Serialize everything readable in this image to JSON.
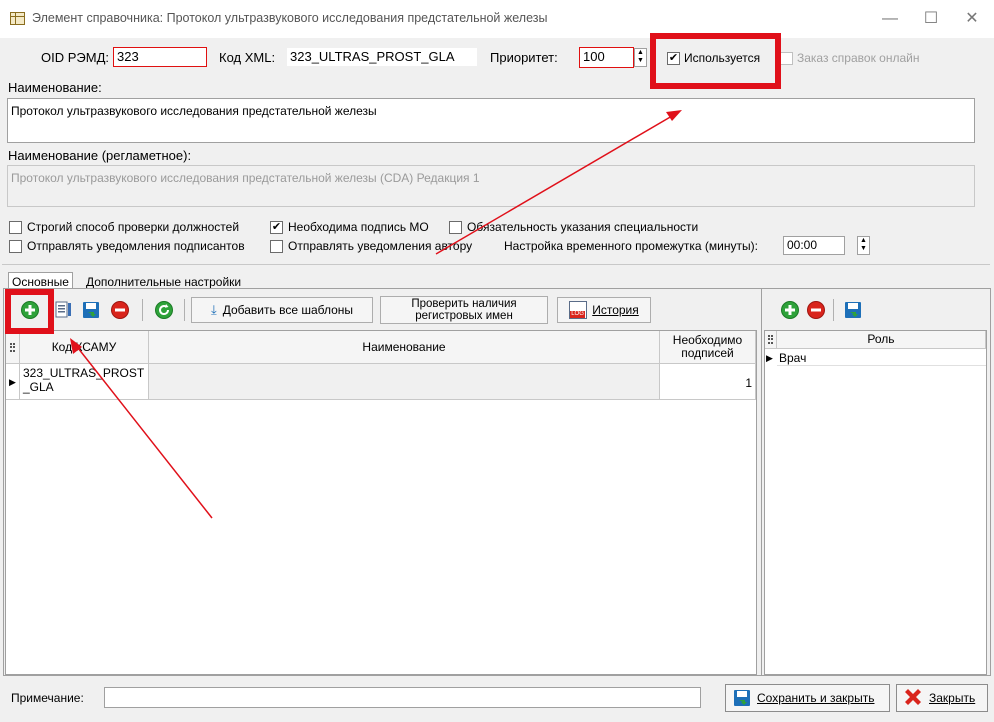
{
  "window": {
    "title": "Элемент справочника: Протокол ультразвукового исследования предстательной железы",
    "minimize": "—",
    "maximize": "☐",
    "close": "✕"
  },
  "fields": {
    "oid_label": "OID РЭМД:",
    "oid_value": "323",
    "xml_label": "Код XML:",
    "xml_value": "323_ULTRAS_PROST_GLA",
    "priority_label": "Приоритет:",
    "priority_value": "100",
    "used_label": "Используется",
    "used_checked": true,
    "online_order_label": "Заказ справок онлайн",
    "name_label": "Наименование:",
    "name_value": "Протокол ультразвукового исследования предстательной железы",
    "reg_name_label": "Наименование (регламетное):",
    "reg_name_value": "Протокол ультразвукового исследования предстательной железы (CDA) Редакция 1"
  },
  "options": {
    "strict_positions": "Строгий способ проверки должностей",
    "mo_signature": "Необходима подпись МО",
    "specialty_required": "Обязательность указания специальности",
    "notify_signers": "Отправлять уведомления подписантов",
    "notify_author": "Отправлять уведомления автору",
    "time_range_label": "Настройка временного промежутка (минуты):",
    "time_range_value": "00:00",
    "mo_signature_checked": true
  },
  "tabs": [
    {
      "label": "Основные"
    },
    {
      "label": "Дополнительные настройки"
    }
  ],
  "toolbar": {
    "add_all_templates": "Добавить все шаблоны",
    "check_names_line1": "Проверить наличия",
    "check_names_line2": "регистровых имен",
    "history": "История",
    "history_badge": "LOG"
  },
  "main_grid": {
    "headers": [
      "Код КСАМУ",
      "Наименование",
      "Необходимо подписей"
    ],
    "header_count_line1": "Необходимо",
    "header_count_line2": "подписей",
    "rows": [
      {
        "code_line1": "323_ULTRAS_PROST",
        "code_line2": "_GLA",
        "name": "",
        "count": "1"
      }
    ]
  },
  "role_grid": {
    "header": "Роль",
    "rows": [
      {
        "role": "Врач"
      }
    ]
  },
  "footer": {
    "note_label": "Примечание:",
    "note_value": "",
    "save_close": "Сохранить и закрыть",
    "close": "Закрыть"
  },
  "colors": {
    "highlight_red": "#e0101a",
    "add_green": "#2ea23a",
    "remove_red": "#d9241c",
    "save_blue": "#1d6fb8"
  }
}
